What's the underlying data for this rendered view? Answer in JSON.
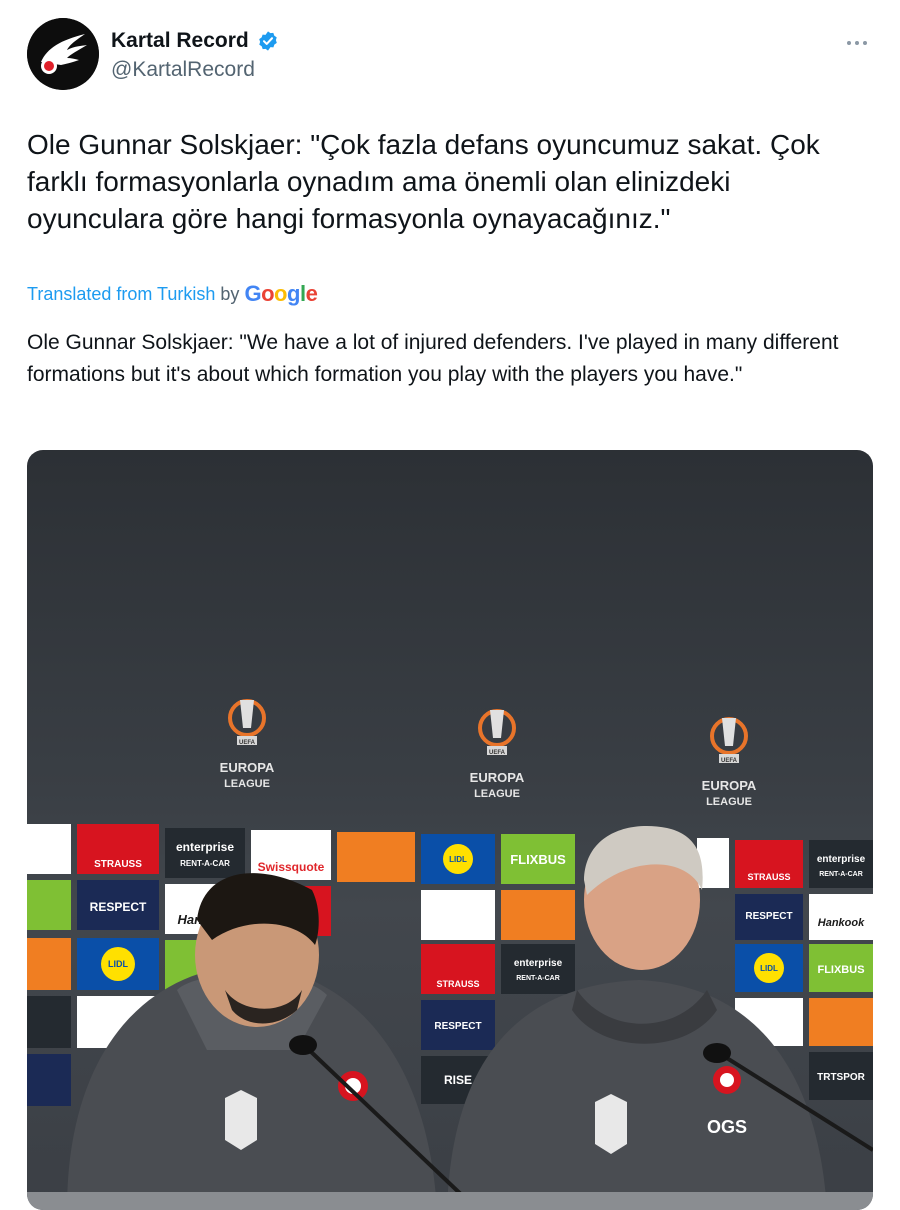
{
  "account": {
    "display_name": "Kartal Record",
    "handle": "@KartalRecord",
    "verified": true
  },
  "tweet": {
    "text": "Ole Gunnar Solskjaer: \"Çok fazla defans oyuncumuz sakat. Çok farklı formasyonlarla oynadım ama önemli olan elinizdeki oyunculara göre hangi formasyonla oynayacağınız.\"",
    "translated_label": "Translated from Turkish",
    "translated_by": "by",
    "translator": "Google",
    "translation": "Ole Gunnar Solskjaer: \"We have a lot of injured defenders. I've played in many different formations but it's about which formation you play with the players you have.\""
  },
  "photo": {
    "league_name_line1": "EUROPA",
    "league_name_line2": "LEAGUE",
    "league_badge": "UEFA",
    "sponsors": {
      "enterprise": "enterprise",
      "rent_a_car": "RENT-A-CAR",
      "strauss": "STRAUSS",
      "swissquote": "Swissquote",
      "lidl": "LIDL",
      "flixbus": "FLIXBUS",
      "respect": "RESPECT",
      "hankook": "Hankook",
      "trt": "TRTSPOR",
      "rise": "RISE"
    },
    "jacket_initials": "OGS"
  },
  "colors": {
    "link": "#1d9bf0",
    "verified": "#1d9bf0",
    "text": "#0f1419",
    "muted": "#536471"
  },
  "icons": [
    "verified-badge-icon",
    "more-options-icon",
    "eagle-logo-icon"
  ]
}
